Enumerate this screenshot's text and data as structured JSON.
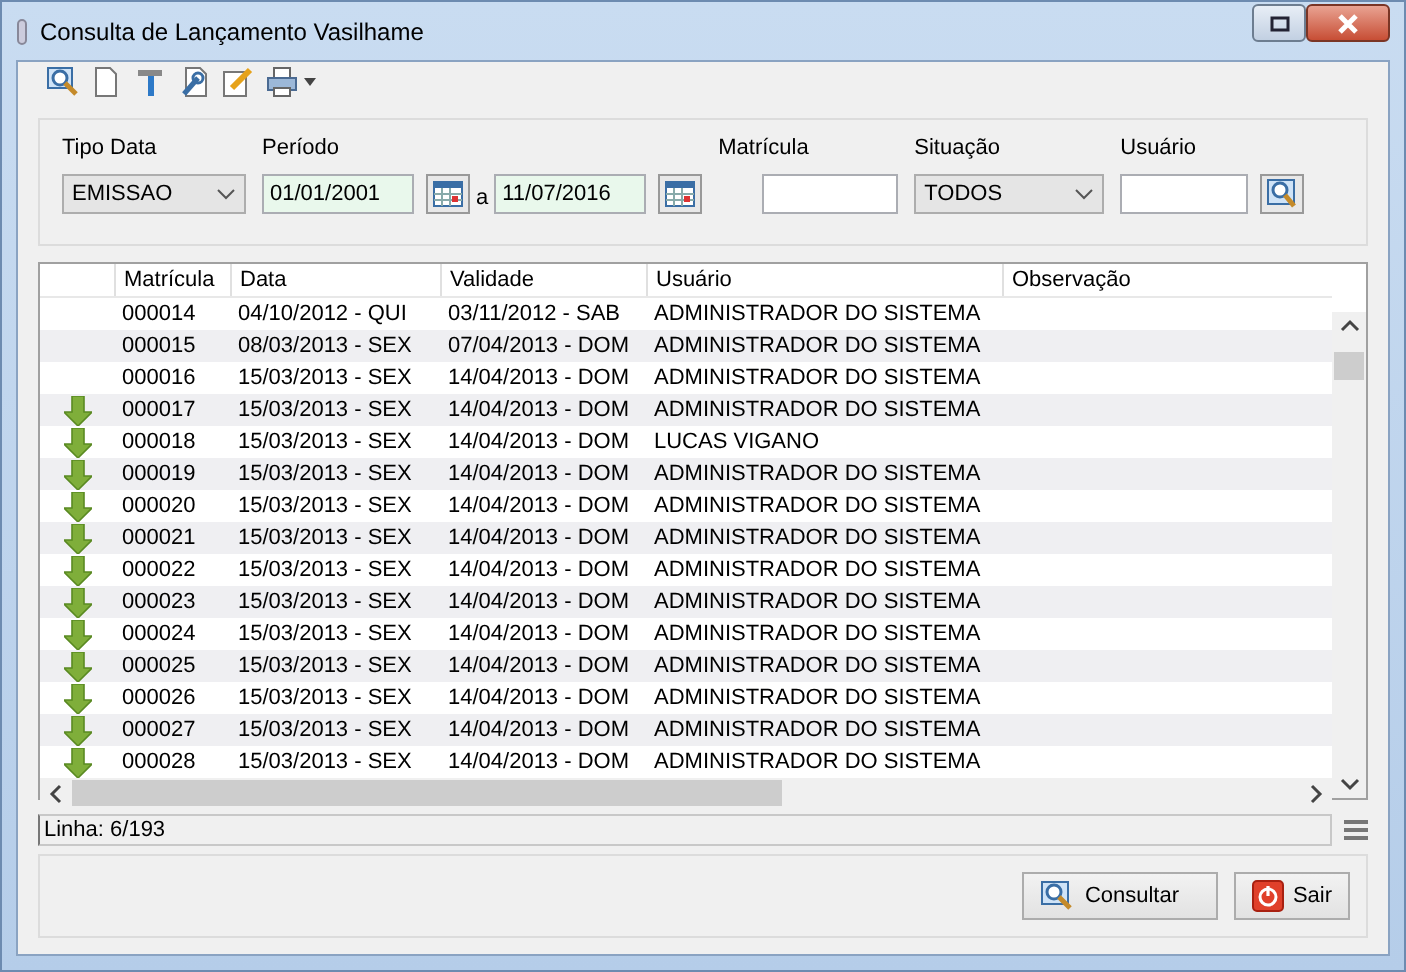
{
  "window": {
    "title": "Consulta de Lançamento Vasilhame"
  },
  "filters": {
    "tipo_data": {
      "label": "Tipo Data",
      "value": "EMISSAO"
    },
    "periodo": {
      "label": "Período",
      "from": "01/01/2001",
      "separator": "a",
      "to": "11/07/2016"
    },
    "matricula": {
      "label": "Matrícula"
    },
    "situacao": {
      "label": "Situação",
      "value": "TODOS"
    },
    "usuario": {
      "label": "Usuário"
    }
  },
  "table": {
    "columns": [
      "Matrícula",
      "Data",
      "Validade",
      "Usuário",
      "Observação"
    ],
    "rows": [
      {
        "arrow": false,
        "cells": [
          "000014",
          "04/10/2012 - QUI",
          "03/11/2012 - SAB",
          "ADMINISTRADOR DO SISTEMA"
        ]
      },
      {
        "arrow": false,
        "cells": [
          "000015",
          "08/03/2013 - SEX",
          "07/04/2013 - DOM",
          "ADMINISTRADOR DO SISTEMA"
        ]
      },
      {
        "arrow": false,
        "cells": [
          "000016",
          "15/03/2013 - SEX",
          "14/04/2013 - DOM",
          "ADMINISTRADOR DO SISTEMA"
        ]
      },
      {
        "arrow": true,
        "cells": [
          "000017",
          "15/03/2013 - SEX",
          "14/04/2013 - DOM",
          "ADMINISTRADOR DO SISTEMA"
        ]
      },
      {
        "arrow": true,
        "cells": [
          "000018",
          "15/03/2013 - SEX",
          "14/04/2013 - DOM",
          "LUCAS VIGANO"
        ]
      },
      {
        "arrow": true,
        "cells": [
          "000019",
          "15/03/2013 - SEX",
          "14/04/2013 - DOM",
          "ADMINISTRADOR DO SISTEMA"
        ]
      },
      {
        "arrow": true,
        "cells": [
          "000020",
          "15/03/2013 - SEX",
          "14/04/2013 - DOM",
          "ADMINISTRADOR DO SISTEMA"
        ]
      },
      {
        "arrow": true,
        "cells": [
          "000021",
          "15/03/2013 - SEX",
          "14/04/2013 - DOM",
          "ADMINISTRADOR DO SISTEMA"
        ]
      },
      {
        "arrow": true,
        "cells": [
          "000022",
          "15/03/2013 - SEX",
          "14/04/2013 - DOM",
          "ADMINISTRADOR DO SISTEMA"
        ]
      },
      {
        "arrow": true,
        "cells": [
          "000023",
          "15/03/2013 - SEX",
          "14/04/2013 - DOM",
          "ADMINISTRADOR DO SISTEMA"
        ]
      },
      {
        "arrow": true,
        "cells": [
          "000024",
          "15/03/2013 - SEX",
          "14/04/2013 - DOM",
          "ADMINISTRADOR DO SISTEMA"
        ]
      },
      {
        "arrow": true,
        "cells": [
          "000025",
          "15/03/2013 - SEX",
          "14/04/2013 - DOM",
          "ADMINISTRADOR DO SISTEMA"
        ]
      },
      {
        "arrow": true,
        "cells": [
          "000026",
          "15/03/2013 - SEX",
          "14/04/2013 - DOM",
          "ADMINISTRADOR DO SISTEMA"
        ]
      },
      {
        "arrow": true,
        "cells": [
          "000027",
          "15/03/2013 - SEX",
          "14/04/2013 - DOM",
          "ADMINISTRADOR DO SISTEMA"
        ]
      },
      {
        "arrow": true,
        "cells": [
          "000028",
          "15/03/2013 - SEX",
          "14/04/2013 - DOM",
          "ADMINISTRADOR DO SISTEMA"
        ]
      }
    ]
  },
  "status_bar": {
    "text": "Linha: 6/193"
  },
  "buttons": [
    {
      "kind": "search",
      "label": "Consultar"
    },
    {
      "kind": "exit",
      "label": "Sair"
    }
  ]
}
